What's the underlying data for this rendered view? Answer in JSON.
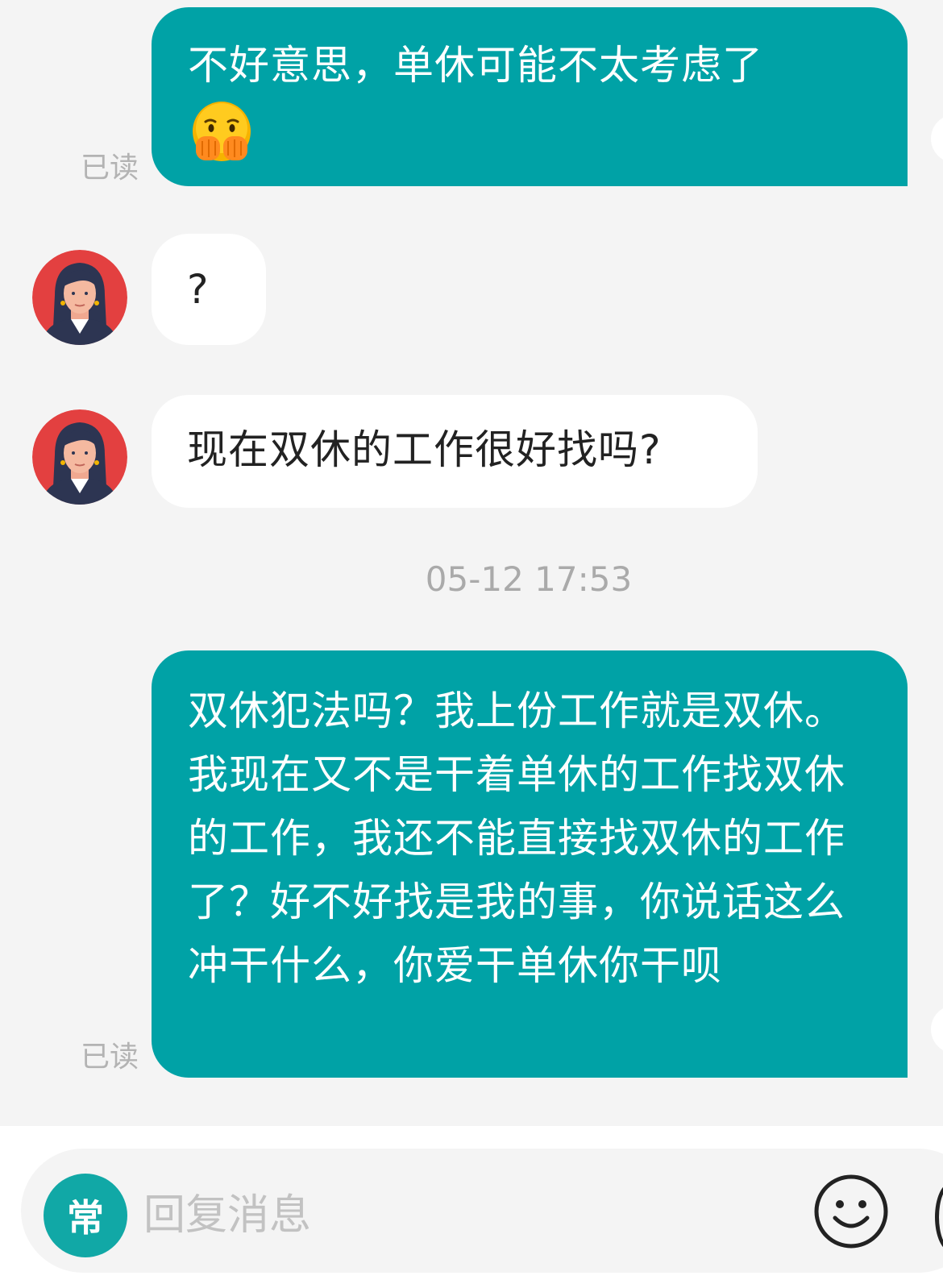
{
  "messages": [
    {
      "side": "sent",
      "text": "不好意思，单休可能不太考虑了",
      "emoji": "🫢",
      "emoji_name": "face-with-hand-over-mouth-icon",
      "read_status": "已读"
    },
    {
      "side": "received",
      "text": "?"
    },
    {
      "side": "received",
      "text": "现在双休的工作很好找吗?"
    },
    {
      "side": "sent",
      "text": "双休犯法吗？我上份工作就是双休。我现在又不是干着单休的工作找双休的工作，我还不能直接找双休的工作了？好不好找是我的事，你说话这么冲干什么，你爱干单休你干呗",
      "read_status": "已读"
    }
  ],
  "timestamp": "05-12 17:53",
  "input_bar": {
    "common_phrase_label": "常",
    "placeholder": "回复消息",
    "emoji_icon": "smiley-icon"
  },
  "colors": {
    "sent_bubble": "#00a2a6",
    "received_bubble": "#ffffff",
    "background": "#f4f4f4",
    "accent_button": "#11a8a6"
  }
}
